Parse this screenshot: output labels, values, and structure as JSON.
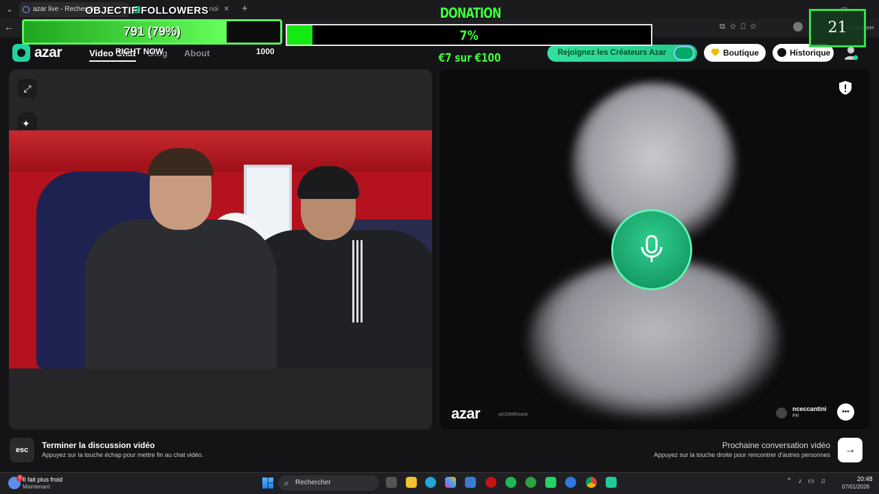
{
  "browser": {
    "tabs": [
      {
        "label": "azar live - Recherche"
      },
      {
        "label": "noi"
      }
    ],
    "new_tab": "+",
    "back": "←",
    "conversion_label": "Conversion"
  },
  "azar": {
    "logo_text": "azar",
    "nav": {
      "video_chat": "Video Chat",
      "blog": "Blog",
      "about": "About"
    },
    "creators_button": "Rejoignez les Créateurs Azar",
    "shop_button": "Boutique",
    "history_button": "Historique",
    "watermark": "azar",
    "watermark_id": "qK59MRowrb",
    "peer": {
      "name": "nceccantini",
      "country": "FR"
    },
    "actions": {
      "esc_key": "esc",
      "end_title": "Terminer la discussion vidéo",
      "end_sub": "Appuyez sur la touche échap pour mettre fin au chat vidéo.",
      "next_title": "Prochaine conversation vidéo",
      "next_sub": "Appuyez sur la touche droite pour rencontrer d'autres personnes",
      "next_arrow": "→"
    }
  },
  "overlay": {
    "followers": {
      "title": "OBJECTIF FOLLOWERS",
      "value": "791 (79%)",
      "progress": 0.79,
      "sub": "RIGHT NOW",
      "goal": "1000"
    },
    "donation": {
      "title": "DONATION",
      "percent": "7%",
      "progress": 0.07,
      "amount": "€7 sur €100"
    },
    "counter": "21"
  },
  "taskbar": {
    "weather_title": "Il fait plus froid",
    "weather_sub": "Maintenant",
    "weather_badge": "2",
    "search_placeholder": "Rechercher",
    "time": "20:48",
    "date": "07/01/2026"
  },
  "colors": {
    "accent": "#22d3a0",
    "overlay_green": "#3eff3e"
  }
}
